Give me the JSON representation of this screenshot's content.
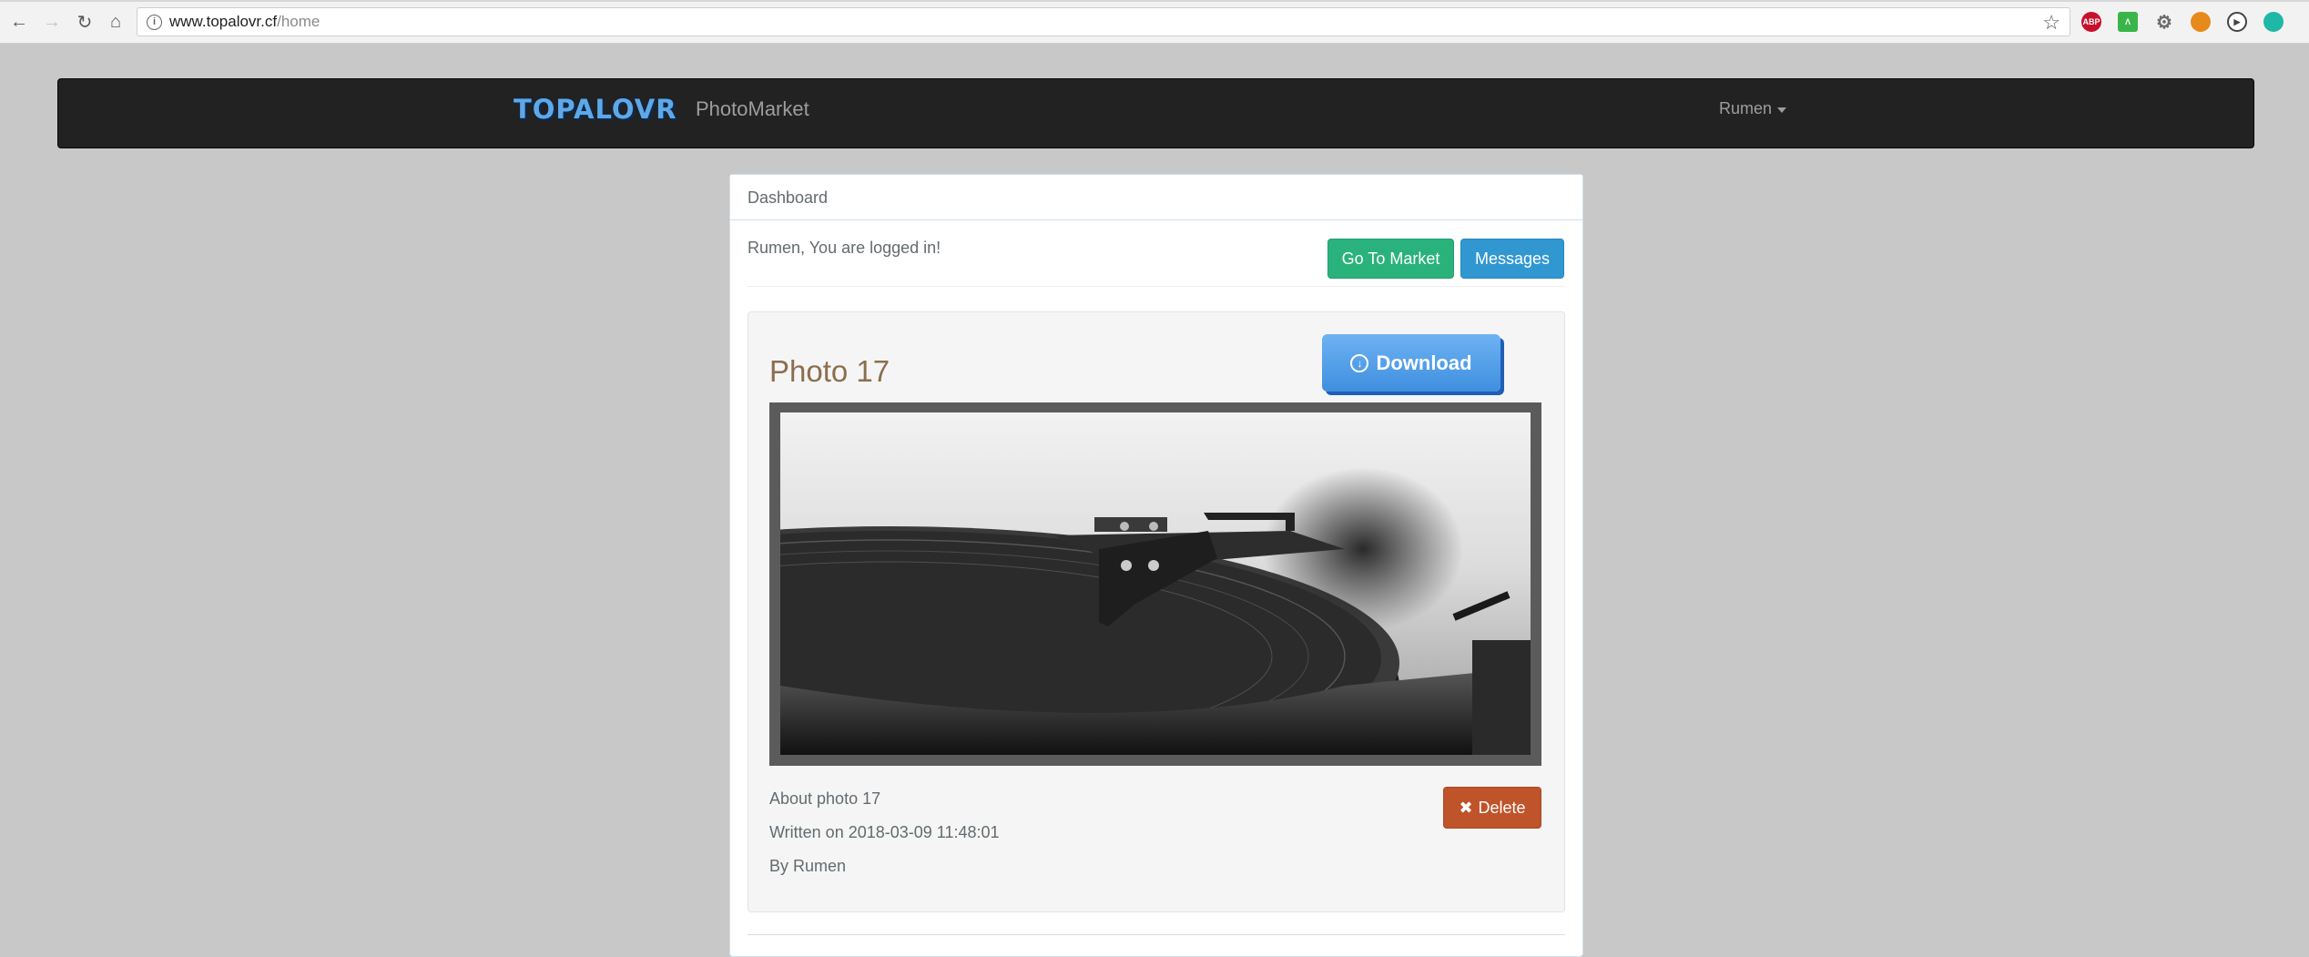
{
  "browser": {
    "url_host": "www.topalovr.cf",
    "url_path": "/home",
    "extensions": [
      {
        "icon": "adblock-icon",
        "label": "ABP",
        "color": "#c8102e"
      },
      {
        "icon": "lab-icon",
        "label": "",
        "color": "#39b54a"
      },
      {
        "icon": "gear-extension-icon",
        "label": "",
        "color": "#6b6b6b"
      },
      {
        "icon": "orange-extension-icon",
        "label": "",
        "color": "#e8891c"
      },
      {
        "icon": "play-extension-icon",
        "label": "",
        "color": "#444444"
      },
      {
        "icon": "teal-extension-icon",
        "label": "",
        "color": "#1fb7a6"
      }
    ]
  },
  "navbar": {
    "logo_text": "TOPALOVR",
    "brand": "PhotoMarket",
    "user": "Rumen"
  },
  "panel": {
    "heading": "Dashboard",
    "status": "Rumen, You are logged in!",
    "go_to_market": "Go To Market",
    "messages": "Messages"
  },
  "photo": {
    "title": "Photo 17",
    "download_label": "Download",
    "about": "About photo 17",
    "written": "Written on 2018-03-09 11:48:01",
    "by": "By Rumen",
    "delete_label": "Delete"
  },
  "colors": {
    "navbar_bg": "#222222",
    "success": "#2ab27b",
    "info": "#3097d1",
    "danger": "#bf5329",
    "download": "#4a98e6"
  }
}
